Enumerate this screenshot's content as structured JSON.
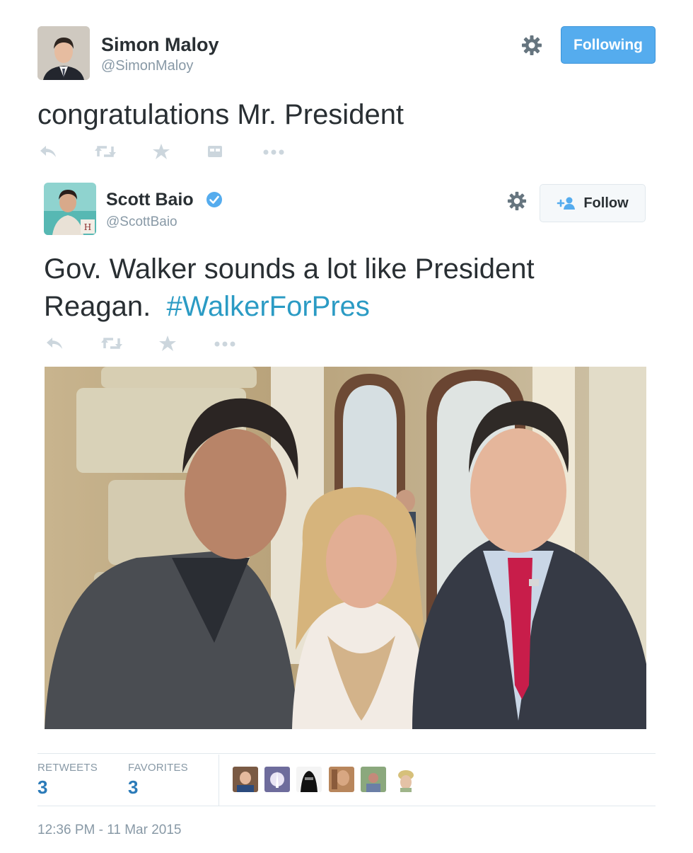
{
  "retweet_tweet": {
    "author": {
      "name": "Simon Maloy",
      "handle": "@SimonMaloy"
    },
    "follow_button": "Following",
    "text": "congratulations Mr. President",
    "actions": [
      "reply-icon",
      "retweet-icon",
      "favorite-icon",
      "embed-icon",
      "more-icon"
    ]
  },
  "quoted_tweet": {
    "author": {
      "name": "Scott Baio",
      "handle": "@ScottBaio",
      "verified": true
    },
    "follow_button": "Follow",
    "text": "Gov. Walker sounds a lot like President Reagan.",
    "hashtag": "#WalkerForPres",
    "actions": [
      "reply-icon",
      "retweet-icon",
      "favorite-icon",
      "more-icon"
    ]
  },
  "stats": {
    "retweets_label": "RETWEETS",
    "retweets_value": "3",
    "favorites_label": "FAVORITES",
    "favorites_value": "3"
  },
  "timestamp": "12:36 PM - 11 Mar 2015",
  "colors": {
    "accent": "#55acee",
    "link": "#2b9bc4",
    "muted": "#8899a6",
    "text": "#292f33"
  }
}
